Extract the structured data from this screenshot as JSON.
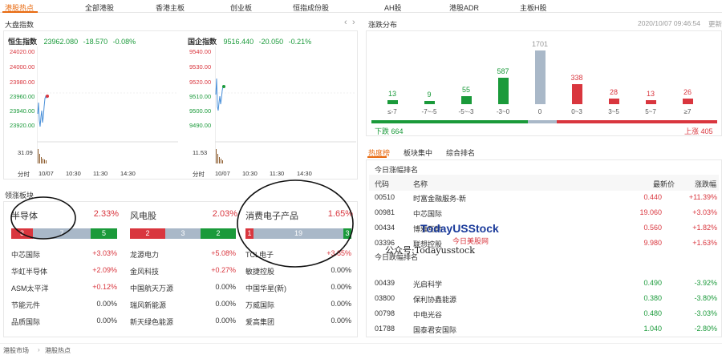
{
  "nav": {
    "tabs": [
      "港股热点",
      "全部港股",
      "香港主板",
      "创业板",
      "恒指成份股",
      "AH股",
      "港股ADR",
      "主板H股"
    ],
    "active": 0
  },
  "index_section": {
    "title": "大盘指数",
    "hsi": {
      "name": "恒生指数",
      "value": "23962.080",
      "change": "-18.570",
      "pct": "-0.08%",
      "y_labels": [
        "24020.00",
        "24000.00",
        "23980.00",
        "23960.00",
        "23940.00",
        "23920.00"
      ],
      "vol_label": "31.09"
    },
    "hscei": {
      "name": "国企指数",
      "value": "9516.440",
      "change": "-20.050",
      "pct": "-0.21%",
      "y_labels": [
        "9540.00",
        "9530.00",
        "9520.00",
        "9510.00",
        "9500.00",
        "9490.00"
      ],
      "vol_label": "11.53"
    },
    "x_labels": [
      "分时",
      "10/07",
      "10:30",
      "11:30",
      "14:30"
    ]
  },
  "sector_section": {
    "title": "领涨板块",
    "cards": [
      {
        "name": "半导体",
        "pct": "2.33%",
        "up": "3",
        "flat": "7",
        "down": "5",
        "stocks": [
          {
            "n": "中芯国际",
            "v": "+3.03%",
            "c": "red"
          },
          {
            "n": "华虹半导体",
            "v": "+2.09%",
            "c": "red"
          },
          {
            "n": "ASM太平洋",
            "v": "+0.12%",
            "c": "red"
          },
          {
            "n": "节能元件",
            "v": "0.00%",
            "c": "k"
          },
          {
            "n": "品质国际",
            "v": "0.00%",
            "c": "k"
          }
        ]
      },
      {
        "name": "风电股",
        "pct": "2.03%",
        "up": "2",
        "flat": "3",
        "down": "2",
        "stocks": [
          {
            "n": "龙源电力",
            "v": "+5.08%",
            "c": "red"
          },
          {
            "n": "金风科技",
            "v": "+0.27%",
            "c": "red"
          },
          {
            "n": "中国航天万源",
            "v": "0.00%",
            "c": "k"
          },
          {
            "n": "瑞风新能源",
            "v": "0.00%",
            "c": "k"
          },
          {
            "n": "新天绿色能源",
            "v": "0.00%",
            "c": "k"
          }
        ]
      },
      {
        "name": "消费电子产品",
        "pct": "1.65%",
        "up": "1",
        "flat": "19",
        "down": "3",
        "stocks": [
          {
            "n": "TCL电子",
            "v": "+3.85%",
            "c": "red"
          },
          {
            "n": "敏捷控股",
            "v": "0.00%",
            "c": "k"
          },
          {
            "n": "中国华星(新)",
            "v": "0.00%",
            "c": "k"
          },
          {
            "n": "万威国际",
            "v": "0.00%",
            "c": "k"
          },
          {
            "n": "爱高集团",
            "v": "0.00%",
            "c": "k"
          }
        ]
      }
    ]
  },
  "distribution": {
    "title": "涨跌分布",
    "timestamp": "2020/10/07 09:46:54",
    "refresh": "更新",
    "buckets": [
      {
        "label": "≤-7",
        "count": "13",
        "c": "green"
      },
      {
        "label": "-7~-5",
        "count": "9",
        "c": "green"
      },
      {
        "label": "-5~-3",
        "count": "55",
        "c": "green"
      },
      {
        "label": "-3~0",
        "count": "587",
        "c": "green"
      },
      {
        "label": "0",
        "count": "1701",
        "c": "flat"
      },
      {
        "label": "0~3",
        "count": "338",
        "c": "red"
      },
      {
        "label": "3~5",
        "count": "28",
        "c": "red"
      },
      {
        "label": "5~7",
        "count": "13",
        "c": "red"
      },
      {
        "label": "≥7",
        "count": "26",
        "c": "red"
      }
    ],
    "down_label": "下跌 664",
    "up_label": "上涨 405",
    "down_total": 664,
    "up_total": 405
  },
  "rank": {
    "tabs": [
      "热度榜",
      "板块集中",
      "综合排名"
    ],
    "gain": {
      "title": "今日涨幅排名",
      "headers": [
        "代码",
        "名称",
        "最新价",
        "涨跌幅"
      ],
      "rows": [
        [
          "00510",
          "时富金融服务-新",
          "0.440",
          "+11.39%"
        ],
        [
          "00981",
          "中芯国际",
          "19.060",
          "+3.03%"
        ],
        [
          "00434",
          "博雅互动",
          "0.560",
          "+1.82%"
        ],
        [
          "03396",
          "联想控股",
          "9.980",
          "+1.63%"
        ]
      ]
    },
    "loss": {
      "title": "今日跌幅排名",
      "rows": [
        [
          "00439",
          "光启科学",
          "0.490",
          "-3.92%"
        ],
        [
          "03800",
          "保利协鑫能源",
          "0.380",
          "-3.80%"
        ],
        [
          "00798",
          "中电光谷",
          "0.480",
          "-3.03%"
        ],
        [
          "01788",
          "国泰君安国际",
          "1.040",
          "-2.80%"
        ]
      ]
    }
  },
  "watermark": {
    "brand": "TodayUSStock",
    "brand_cn": "今日美股网",
    "wechat": "公众号:Todayusstock"
  },
  "breadcrumb": {
    "a": "港股市场",
    "b": "港股热点"
  },
  "colors": {
    "up": "#d9363e",
    "down": "#1a9a3a",
    "flat": "#a9b8c8",
    "accent": "#e86a10"
  }
}
